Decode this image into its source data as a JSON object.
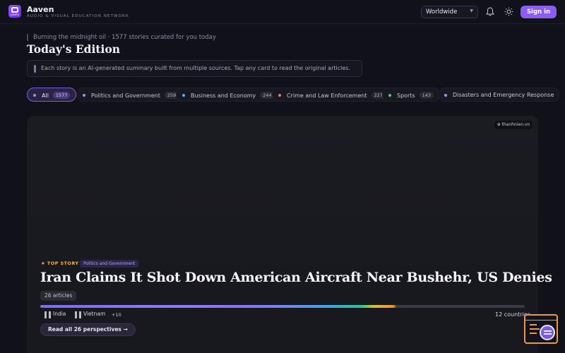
{
  "brand": {
    "name": "Aaven",
    "tagline": "AUDIO & VISUAL EDUCATION NETWORK",
    "logo_text": "AAVEN",
    "accent_color": "#8b5cf6"
  },
  "header": {
    "region": "Worldwide",
    "signin_label": "Sign in",
    "icons": [
      "bell-icon",
      "sun-icon",
      "chevron-down-icon"
    ]
  },
  "intro": {
    "subline": "Burning the midnight oil · 1577 stories curated for you today",
    "title": "Today's Edition",
    "info": "Each story is an AI-generated summary built from multiple sources. Tap any card to read the original articles."
  },
  "categories": [
    {
      "label": "All",
      "count": "1577",
      "color": "#a78bfa",
      "active": true
    },
    {
      "label": "Politics and Government",
      "count": "259",
      "color": "#a78bfa",
      "active": false
    },
    {
      "label": "Business and Economy",
      "count": "244",
      "color": "#38bdf8",
      "active": false
    },
    {
      "label": "Crime and Law Enforcement",
      "count": "227",
      "color": "#f87171",
      "active": false
    },
    {
      "label": "Sports",
      "count": "143",
      "color": "#34d399",
      "active": false
    },
    {
      "label": "Disasters and Emergency Response",
      "count": "",
      "color": "#a78bfa",
      "active": false
    }
  ],
  "hero": {
    "source": "⊕ thanhnien.vn",
    "badge": "★ TOP STORY",
    "category": "Politics and Government",
    "headline": "Iran Claims It Shot Down American Aircraft Near Bushehr, US Denies",
    "articles": "26 articles",
    "countries": [
      {
        "name": "India"
      },
      {
        "name": "Vietnam"
      }
    ],
    "more_countries": "+10",
    "countries_total": "12 countries",
    "read_all": "Read all 26 perspectives →"
  }
}
